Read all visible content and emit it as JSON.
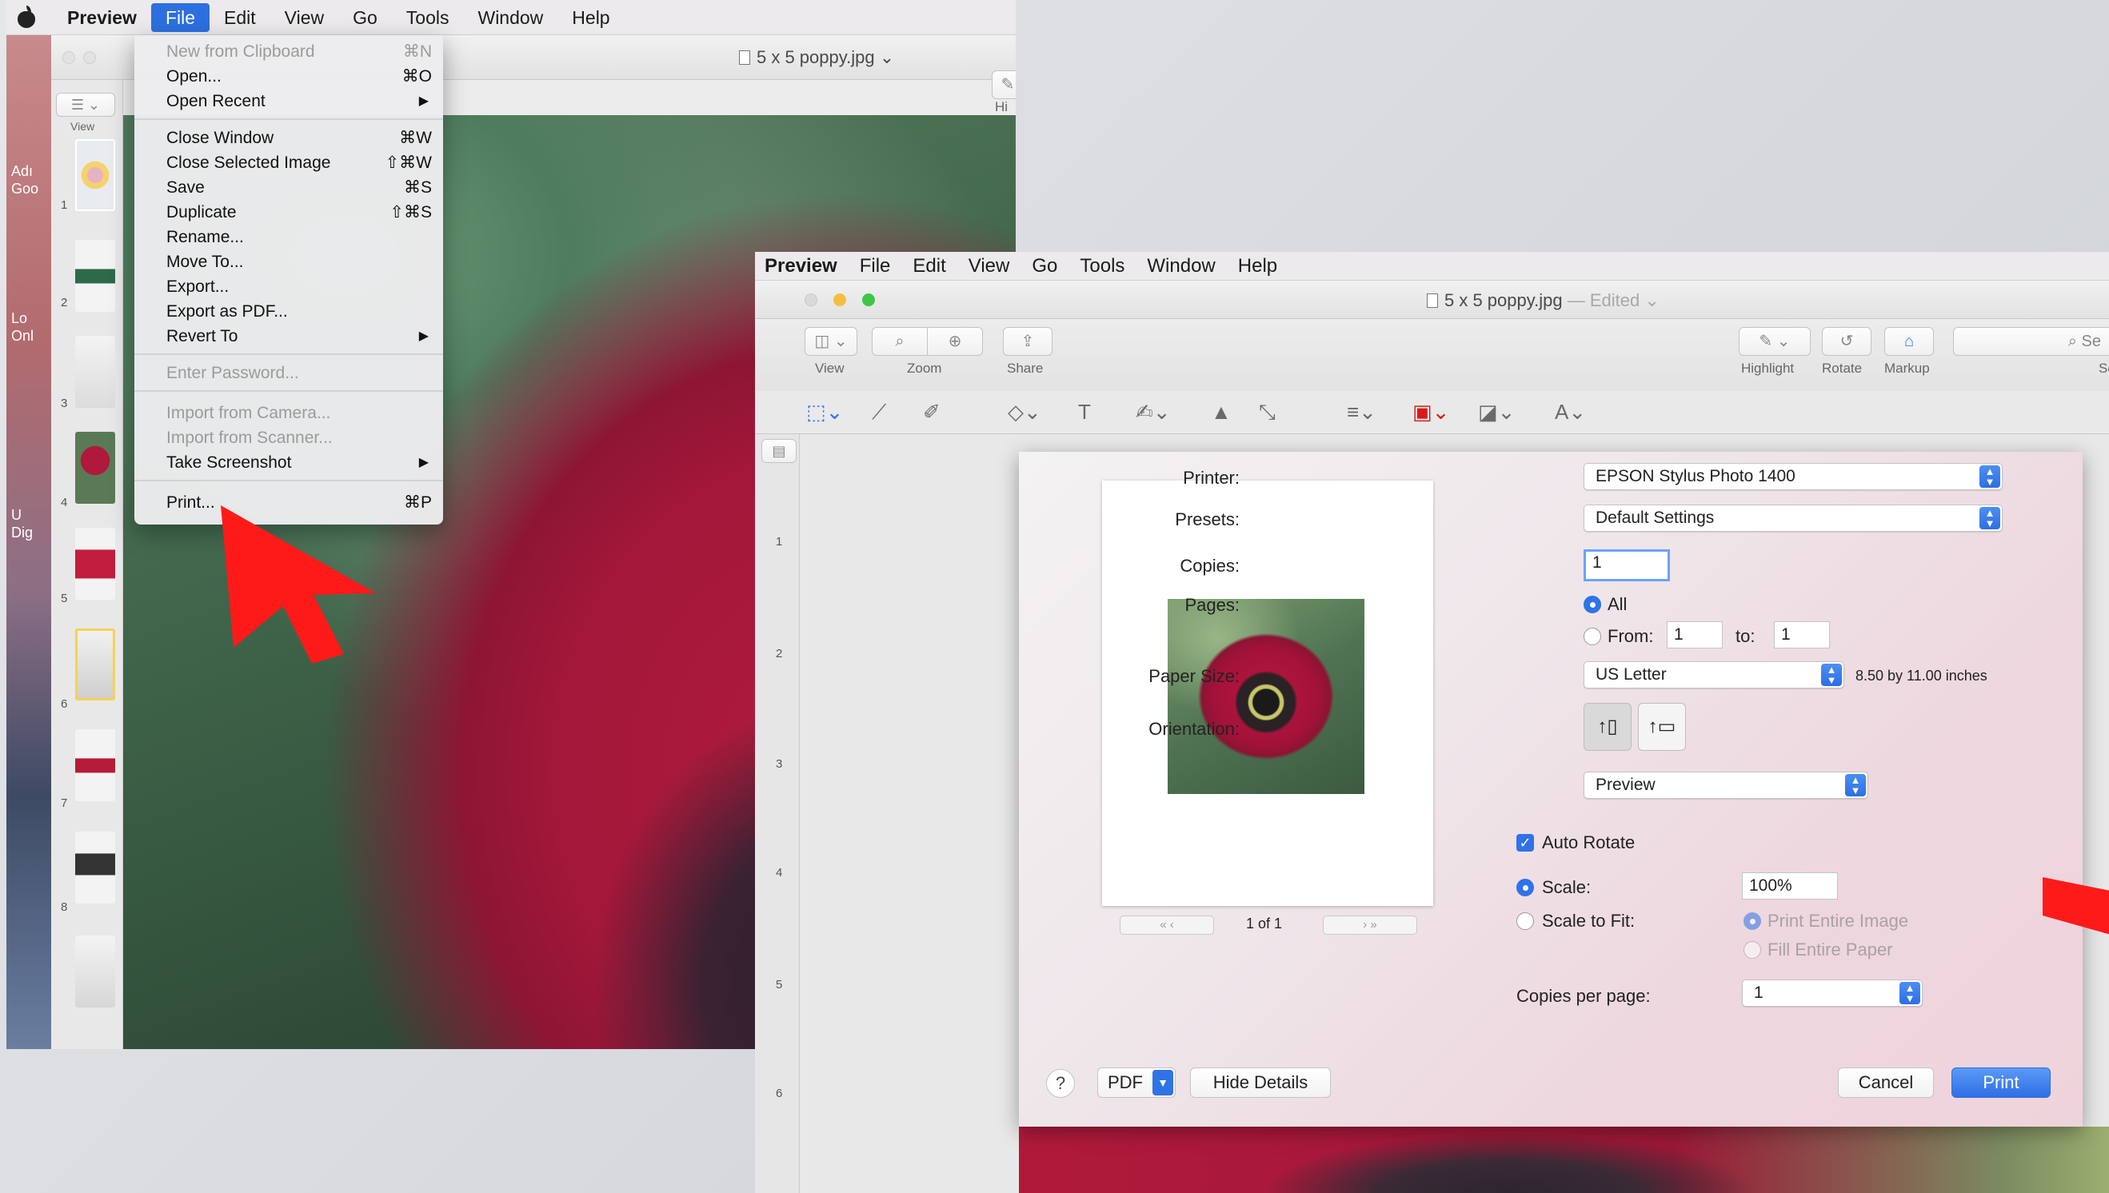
{
  "left": {
    "menubar": [
      "Preview",
      "File",
      "Edit",
      "View",
      "Go",
      "Tools",
      "Window",
      "Help"
    ],
    "window_title": "5 x 5 poppy.jpg",
    "toolbar": {
      "view_label": "View",
      "highlight_label": "Hi"
    },
    "desktop_labels": [
      "Adı",
      "Goo",
      "Lo",
      "Onl",
      "U",
      "Dig"
    ],
    "file_menu": [
      {
        "label": "New from Clipboard",
        "shortcut": "⌘N",
        "disabled": true
      },
      {
        "label": "Open...",
        "shortcut": "⌘O",
        "disabled": false
      },
      {
        "label": "Open Recent",
        "shortcut": "",
        "submenu": true,
        "disabled": false
      },
      {
        "label": "Close Window",
        "shortcut": "⌘W",
        "disabled": false
      },
      {
        "label": "Close Selected Image",
        "shortcut": "⇧⌘W",
        "disabled": false
      },
      {
        "label": "Save",
        "shortcut": "⌘S",
        "disabled": false
      },
      {
        "label": "Duplicate",
        "shortcut": "⇧⌘S",
        "disabled": false
      },
      {
        "label": "Rename...",
        "shortcut": "",
        "disabled": false
      },
      {
        "label": "Move To...",
        "shortcut": "",
        "disabled": false
      },
      {
        "label": "Export...",
        "shortcut": "",
        "disabled": false
      },
      {
        "label": "Export as PDF...",
        "shortcut": "",
        "disabled": false
      },
      {
        "label": "Revert To",
        "shortcut": "",
        "submenu": true,
        "disabled": false
      },
      {
        "label": "Enter Password...",
        "shortcut": "",
        "disabled": true
      },
      {
        "label": "Import from Camera...",
        "shortcut": "",
        "disabled": true
      },
      {
        "label": "Import from Scanner...",
        "shortcut": "",
        "disabled": true
      },
      {
        "label": "Take Screenshot",
        "shortcut": "",
        "submenu": true,
        "disabled": false
      },
      {
        "label": "Print...",
        "shortcut": "⌘P",
        "disabled": false
      }
    ],
    "page_numbers": [
      "1",
      "2",
      "3",
      "4",
      "5",
      "6",
      "7",
      "8"
    ]
  },
  "right": {
    "menubar": [
      "Preview",
      "File",
      "Edit",
      "View",
      "Go",
      "Tools",
      "Window",
      "Help"
    ],
    "window_title": "5 x 5 poppy.jpg",
    "window_status": "— Edited",
    "toolbar": {
      "view_label": "View",
      "zoom_label": "Zoom",
      "share_label": "Share",
      "highlight_label": "Highlight",
      "rotate_label": "Rotate",
      "markup_label": "Markup",
      "search_label": "Se",
      "search_placeholder": "Se"
    },
    "page_numbers": [
      "1",
      "2",
      "3",
      "4",
      "5",
      "6"
    ],
    "print": {
      "printer_label": "Printer:",
      "printer_value": "EPSON Stylus Photo 1400",
      "presets_label": "Presets:",
      "presets_value": "Default Settings",
      "copies_label": "Copies:",
      "copies_value": "1",
      "pages_label": "Pages:",
      "pages_all": "All",
      "pages_from": "From:",
      "pages_from_value": "1",
      "pages_to": "to:",
      "pages_to_value": "1",
      "paper_size_label": "Paper Size:",
      "paper_size_value": "US Letter",
      "paper_size_dims": "8.50 by 11.00 inches",
      "orientation_label": "Orientation:",
      "section_value": "Preview",
      "auto_rotate": "Auto Rotate",
      "scale_label": "Scale:",
      "scale_value": "100%",
      "scale_to_fit": "Scale to Fit:",
      "print_entire_image": "Print Entire Image",
      "fill_entire_paper": "Fill Entire Paper",
      "copies_per_page_label": "Copies per page:",
      "copies_per_page_value": "1",
      "page_indicator": "1 of 1",
      "help": "?",
      "pdf": "PDF",
      "hide_details": "Hide Details",
      "cancel": "Cancel",
      "print": "Print"
    }
  },
  "colors": {
    "accent": "#2f73e6",
    "annotation_arrow": "#ff1a1a"
  }
}
